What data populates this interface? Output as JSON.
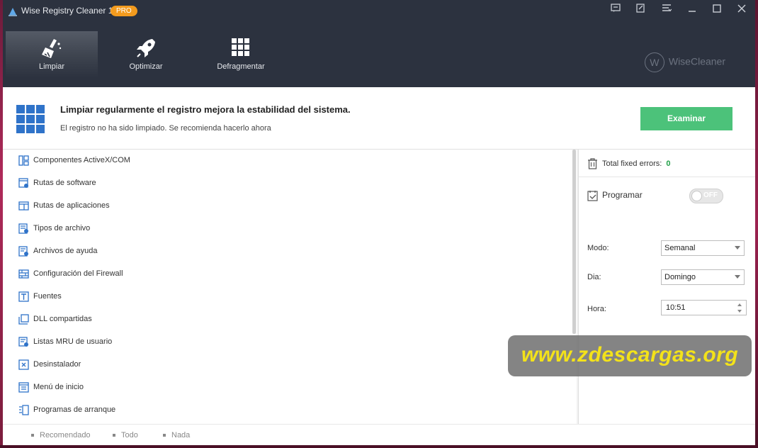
{
  "app": {
    "title": "Wise Registry Cleaner 11",
    "badge": "PRO",
    "brand": "WiseCleaner",
    "brand_logo_letter": "W"
  },
  "window_controls": {
    "icons": [
      "feedback-icon",
      "skin-icon",
      "menu-icon",
      "minimize-icon",
      "maximize-icon",
      "close-icon"
    ]
  },
  "nav": {
    "tabs": [
      {
        "label": "Limpiar",
        "icon": "broom-icon",
        "active": true
      },
      {
        "label": "Optimizar",
        "icon": "rocket-icon",
        "active": false
      },
      {
        "label": "Defragmentar",
        "icon": "defrag-grid-icon",
        "active": false
      }
    ]
  },
  "banner": {
    "title": "Limpiar regularmente el registro mejora la estabilidad del sistema.",
    "subtitle": "El registro no ha sido limpiado. Se recomienda hacerlo ahora",
    "scan_button": "Examinar"
  },
  "categories": [
    {
      "label": "Componentes ActiveX/COM",
      "icon": "activex-icon"
    },
    {
      "label": "Rutas de software",
      "icon": "software-path-icon"
    },
    {
      "label": "Rutas de aplicaciones",
      "icon": "app-path-icon"
    },
    {
      "label": "Tipos de archivo",
      "icon": "file-type-icon"
    },
    {
      "label": "Archivos de ayuda",
      "icon": "help-file-icon"
    },
    {
      "label": "Configuración del Firewall",
      "icon": "firewall-icon"
    },
    {
      "label": "Fuentes",
      "icon": "font-icon"
    },
    {
      "label": "DLL compartidas",
      "icon": "dll-icon"
    },
    {
      "label": "Listas MRU de usuario",
      "icon": "mru-icon"
    },
    {
      "label": "Desinstalador",
      "icon": "uninstaller-icon"
    },
    {
      "label": "Menú de inicio",
      "icon": "start-menu-icon"
    },
    {
      "label": "Programas de arranque",
      "icon": "startup-icon"
    }
  ],
  "side": {
    "fixed_label": "Total fixed errors:",
    "fixed_value": "0",
    "schedule_label": "Programar",
    "schedule_toggle": "OFF",
    "mode_label": "Modo:",
    "mode_value": "Semanal",
    "day_label": "Dia:",
    "day_value": "Domingo",
    "time_label": "Hora:",
    "time_value": "10:51"
  },
  "footer": {
    "options": [
      "Recomendado",
      "Todo",
      "Nada"
    ]
  },
  "watermark": "www.zdescargas.org",
  "colors": {
    "header_bg": "#2c323f",
    "accent_green": "#4cc27a",
    "pro_badge": "#f39b1e",
    "icon_blue": "#2f73c9",
    "watermark_text": "#f3e21a"
  }
}
